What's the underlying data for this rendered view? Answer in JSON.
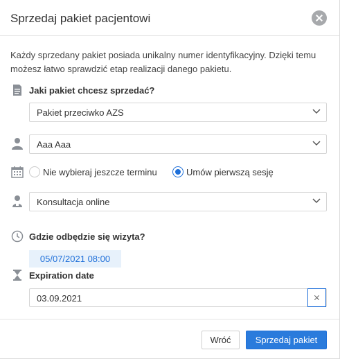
{
  "dialog": {
    "title": "Sprzedaj pakiet pacjentowi",
    "description": "Każdy sprzedany pakiet posiada unikalny numer identyfikacyjny. Dzięki temu możesz łatwo sprawdzić etap realizacji danego pakietu."
  },
  "package": {
    "label": "Jaki pakiet chcesz sprzedać?",
    "selected": "Pakiet przeciwko AZS"
  },
  "patient": {
    "selected": "Aaa Aaa"
  },
  "schedule": {
    "options": [
      {
        "label": "Nie wybieraj jeszcze terminu",
        "checked": false
      },
      {
        "label": "Umów pierwszą sesję",
        "checked": true
      }
    ]
  },
  "service": {
    "selected": "Konsultacja online"
  },
  "visit": {
    "label": "Gdzie odbędzie się wizyta?",
    "datetime": "05/07/2021 08:00"
  },
  "expiration": {
    "label": "Expiration date",
    "value": "03.09.2021"
  },
  "footer": {
    "back_label": "Wróć",
    "submit_label": "Sprzedaj pakiet"
  },
  "colors": {
    "accent": "#2a7bdc",
    "icon": "#8a8f96",
    "chip_bg": "#e7f1fb"
  },
  "icons": [
    "close-icon",
    "document-icon",
    "person-icon",
    "calendar-icon",
    "specialist-icon",
    "clock-icon",
    "hourglass-icon",
    "chevron-down-icon"
  ]
}
